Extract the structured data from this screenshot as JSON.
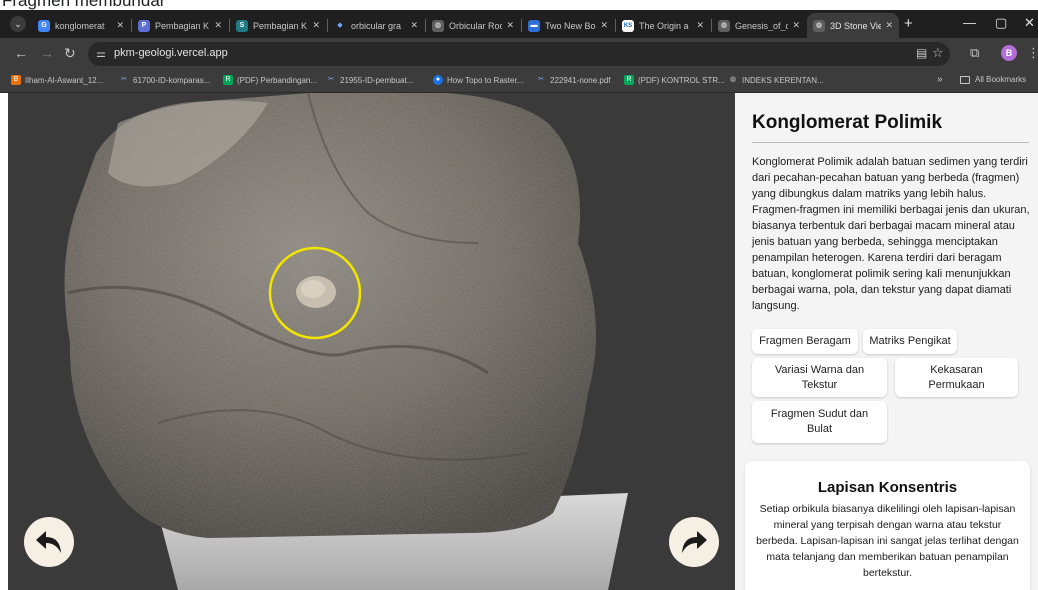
{
  "caption": "Fragmen membundar",
  "browser": {
    "tabs": [
      {
        "label": "konglomerat",
        "favicon": "google-icon",
        "color": "#4285f4",
        "glyph": "G",
        "active": false
      },
      {
        "label": "Pembagian K",
        "favicon": "gamma-icon",
        "color": "#5b6fd6",
        "glyph": "P",
        "active": false
      },
      {
        "label": "Pembagian K",
        "favicon": "scribd-icon",
        "color": "#1e7b85",
        "glyph": "S",
        "active": false
      },
      {
        "label": "orbicular gra",
        "favicon": "diamond-icon",
        "color": "#6aa9ff",
        "glyph": "◆",
        "active": false
      },
      {
        "label": "Orbicular Roc",
        "favicon": "globe-icon",
        "color": "#8c8c8c",
        "glyph": "◍",
        "active": false
      },
      {
        "label": "Two New Bo",
        "favicon": "image-icon",
        "color": "#2e6fd8",
        "glyph": "▬",
        "active": false
      },
      {
        "label": "The Origin a",
        "favicon": "ks-icon",
        "color": "#ffffff",
        "glyph": "KS",
        "active": false
      },
      {
        "label": "Genesis_of_c",
        "favicon": "globe-icon",
        "color": "#8c8c8c",
        "glyph": "◍",
        "active": false
      },
      {
        "label": "3D Stone Vie",
        "favicon": "globe-icon",
        "color": "#8c8c8c",
        "glyph": "◍",
        "active": true
      }
    ],
    "new_tab": "+",
    "url": "pkm-geologi.vercel.app",
    "bookmarks": [
      {
        "label": "Ilham-Al-Aswant_12...",
        "color": "#e8710a",
        "glyph": "B"
      },
      {
        "label": "61700-ID-komparas...",
        "color": "#3c3c3c",
        "glyph": "✂"
      },
      {
        "label": "(PDF) Perbandingan...",
        "color": "#00a65a",
        "glyph": "R"
      },
      {
        "label": "21955-ID-pembuat...",
        "color": "#3c3c3c",
        "glyph": "✂"
      },
      {
        "label": "How Topo to Raster...",
        "color": "#1a73e8",
        "glyph": "●"
      },
      {
        "label": "222941-none.pdf",
        "color": "#3c3c3c",
        "glyph": "✂"
      },
      {
        "label": "(PDF) KONTROL STR...",
        "color": "#00a65a",
        "glyph": "R"
      },
      {
        "label": "INDEKS KERENTAN...",
        "color": "#3c3c3c",
        "glyph": "◍"
      }
    ],
    "more_bookmarks": "»",
    "all_bookmarks": "All Bookmarks",
    "profile_initial": "B"
  },
  "panel": {
    "title": "Konglomerat Polimik",
    "description": "Konglomerat Polimik adalah batuan sedimen yang terdiri dari pecahan-pecahan batuan yang berbeda (fragmen) yang dibungkus dalam matriks yang lebih halus. Fragmen-fragmen ini memiliki berbagai jenis dan ukuran, biasanya terbentuk dari berbagai macam mineral atau jenis batuan yang berbeda, sehingga menciptakan penampilan heterogen. Karena terdiri dari beragam batuan, konglomerat polimik sering kali menunjukkan berbagai warna, pola, dan tekstur yang dapat diamati langsung.",
    "features": {
      "f1": "Fragmen Beragam",
      "f2": "Matriks Pengikat",
      "f3": "Variasi Warna dan Tekstur",
      "f4": "Kekasaran Permukaan",
      "f5": "Fragmen Sudut dan Bulat"
    },
    "card": {
      "title": "Lapisan Konsentris",
      "text": "Setiap orbikula biasanya dikelilingi oleh lapisan-lapisan mineral yang terpisah dengan warna atau tekstur berbeda. Lapisan-lapisan ini sangat jelas terlihat dengan mata telanjang dan memberikan batuan penampilan bertekstur."
    }
  },
  "viewer": {
    "highlight_color": "#f2e600"
  }
}
